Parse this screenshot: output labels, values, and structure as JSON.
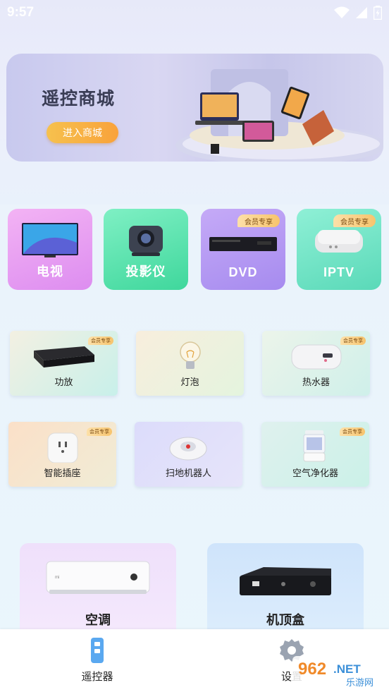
{
  "status_bar": {
    "time": "9:57",
    "icons": [
      "wifi-icon",
      "signal-icon",
      "battery-icon"
    ]
  },
  "banner": {
    "title": "遥控商城",
    "button_label": "进入商城"
  },
  "vip_label": "会员专享",
  "big_devices": [
    {
      "label": "电视",
      "vip": false,
      "color": "#e79cf1"
    },
    {
      "label": "投影仪",
      "vip": false,
      "color": "#5fe3ad"
    },
    {
      "label": "DVD",
      "vip": true,
      "color": "#b49af3"
    },
    {
      "label": "IPTV",
      "vip": true,
      "color": "#6fe6c6"
    }
  ],
  "mid_devices": [
    {
      "label": "功放",
      "vip": true
    },
    {
      "label": "灯泡",
      "vip": false
    },
    {
      "label": "热水器",
      "vip": true
    },
    {
      "label": "智能插座",
      "vip": true
    },
    {
      "label": "扫地机器人",
      "vip": false
    },
    {
      "label": "空气净化器",
      "vip": true
    }
  ],
  "bottom_devices": [
    {
      "label": "空调"
    },
    {
      "label": "机顶盒"
    }
  ],
  "tabbar": {
    "tabs": [
      {
        "label": "遥控器",
        "icon": "remote-icon"
      },
      {
        "label": "设置",
        "icon": "gear-icon"
      }
    ]
  },
  "watermark": {
    "text": "962.NET",
    "sub": "乐游网"
  }
}
